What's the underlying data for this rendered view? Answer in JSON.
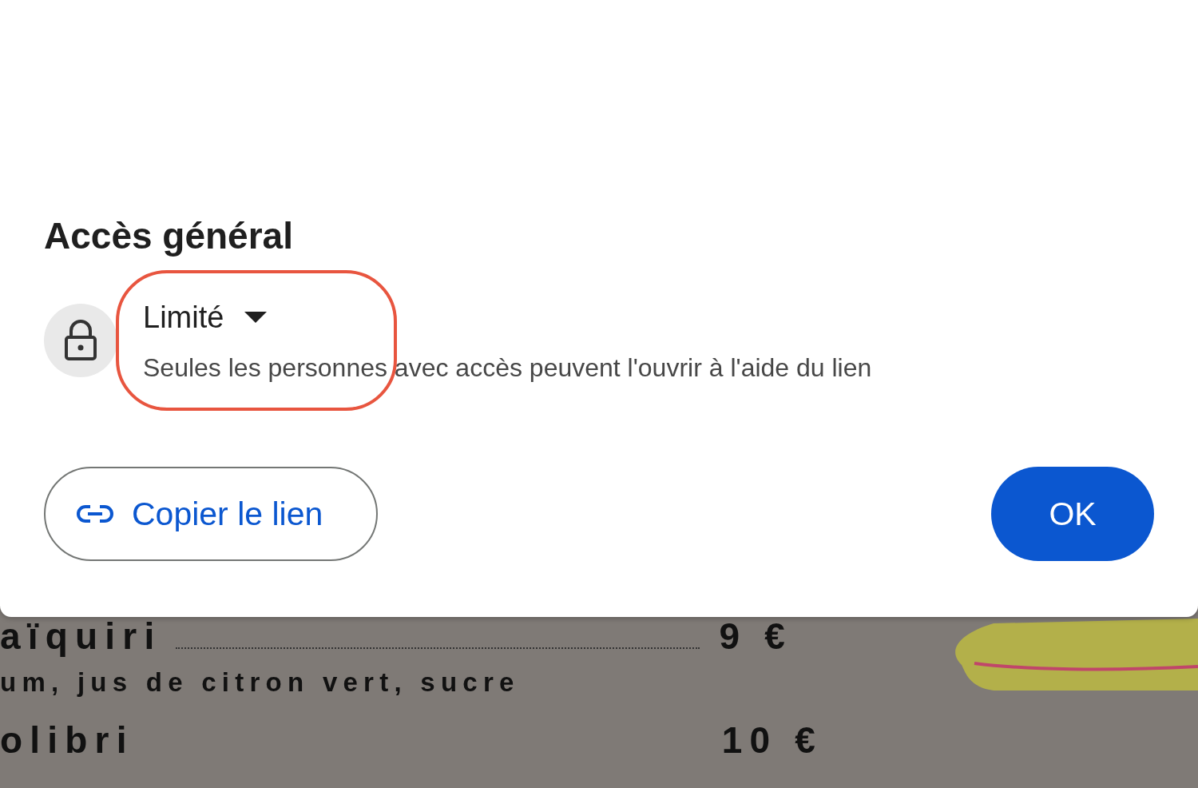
{
  "dialog": {
    "heading": "Accès général",
    "access": {
      "label": "Limité",
      "description": "Seules les personnes avec accès peuvent l'ouvrir à l'aide du lien"
    },
    "buttons": [
      {
        "label": "Copier le lien",
        "kind": "outlined"
      },
      {
        "label": "OK",
        "kind": "filled"
      }
    ]
  },
  "menu": {
    "items": [
      {
        "name": "aïquiri",
        "price": "9 €",
        "description": "um, jus de citron vert, sucre"
      },
      {
        "name": "olibri",
        "price": "10 €"
      }
    ]
  }
}
